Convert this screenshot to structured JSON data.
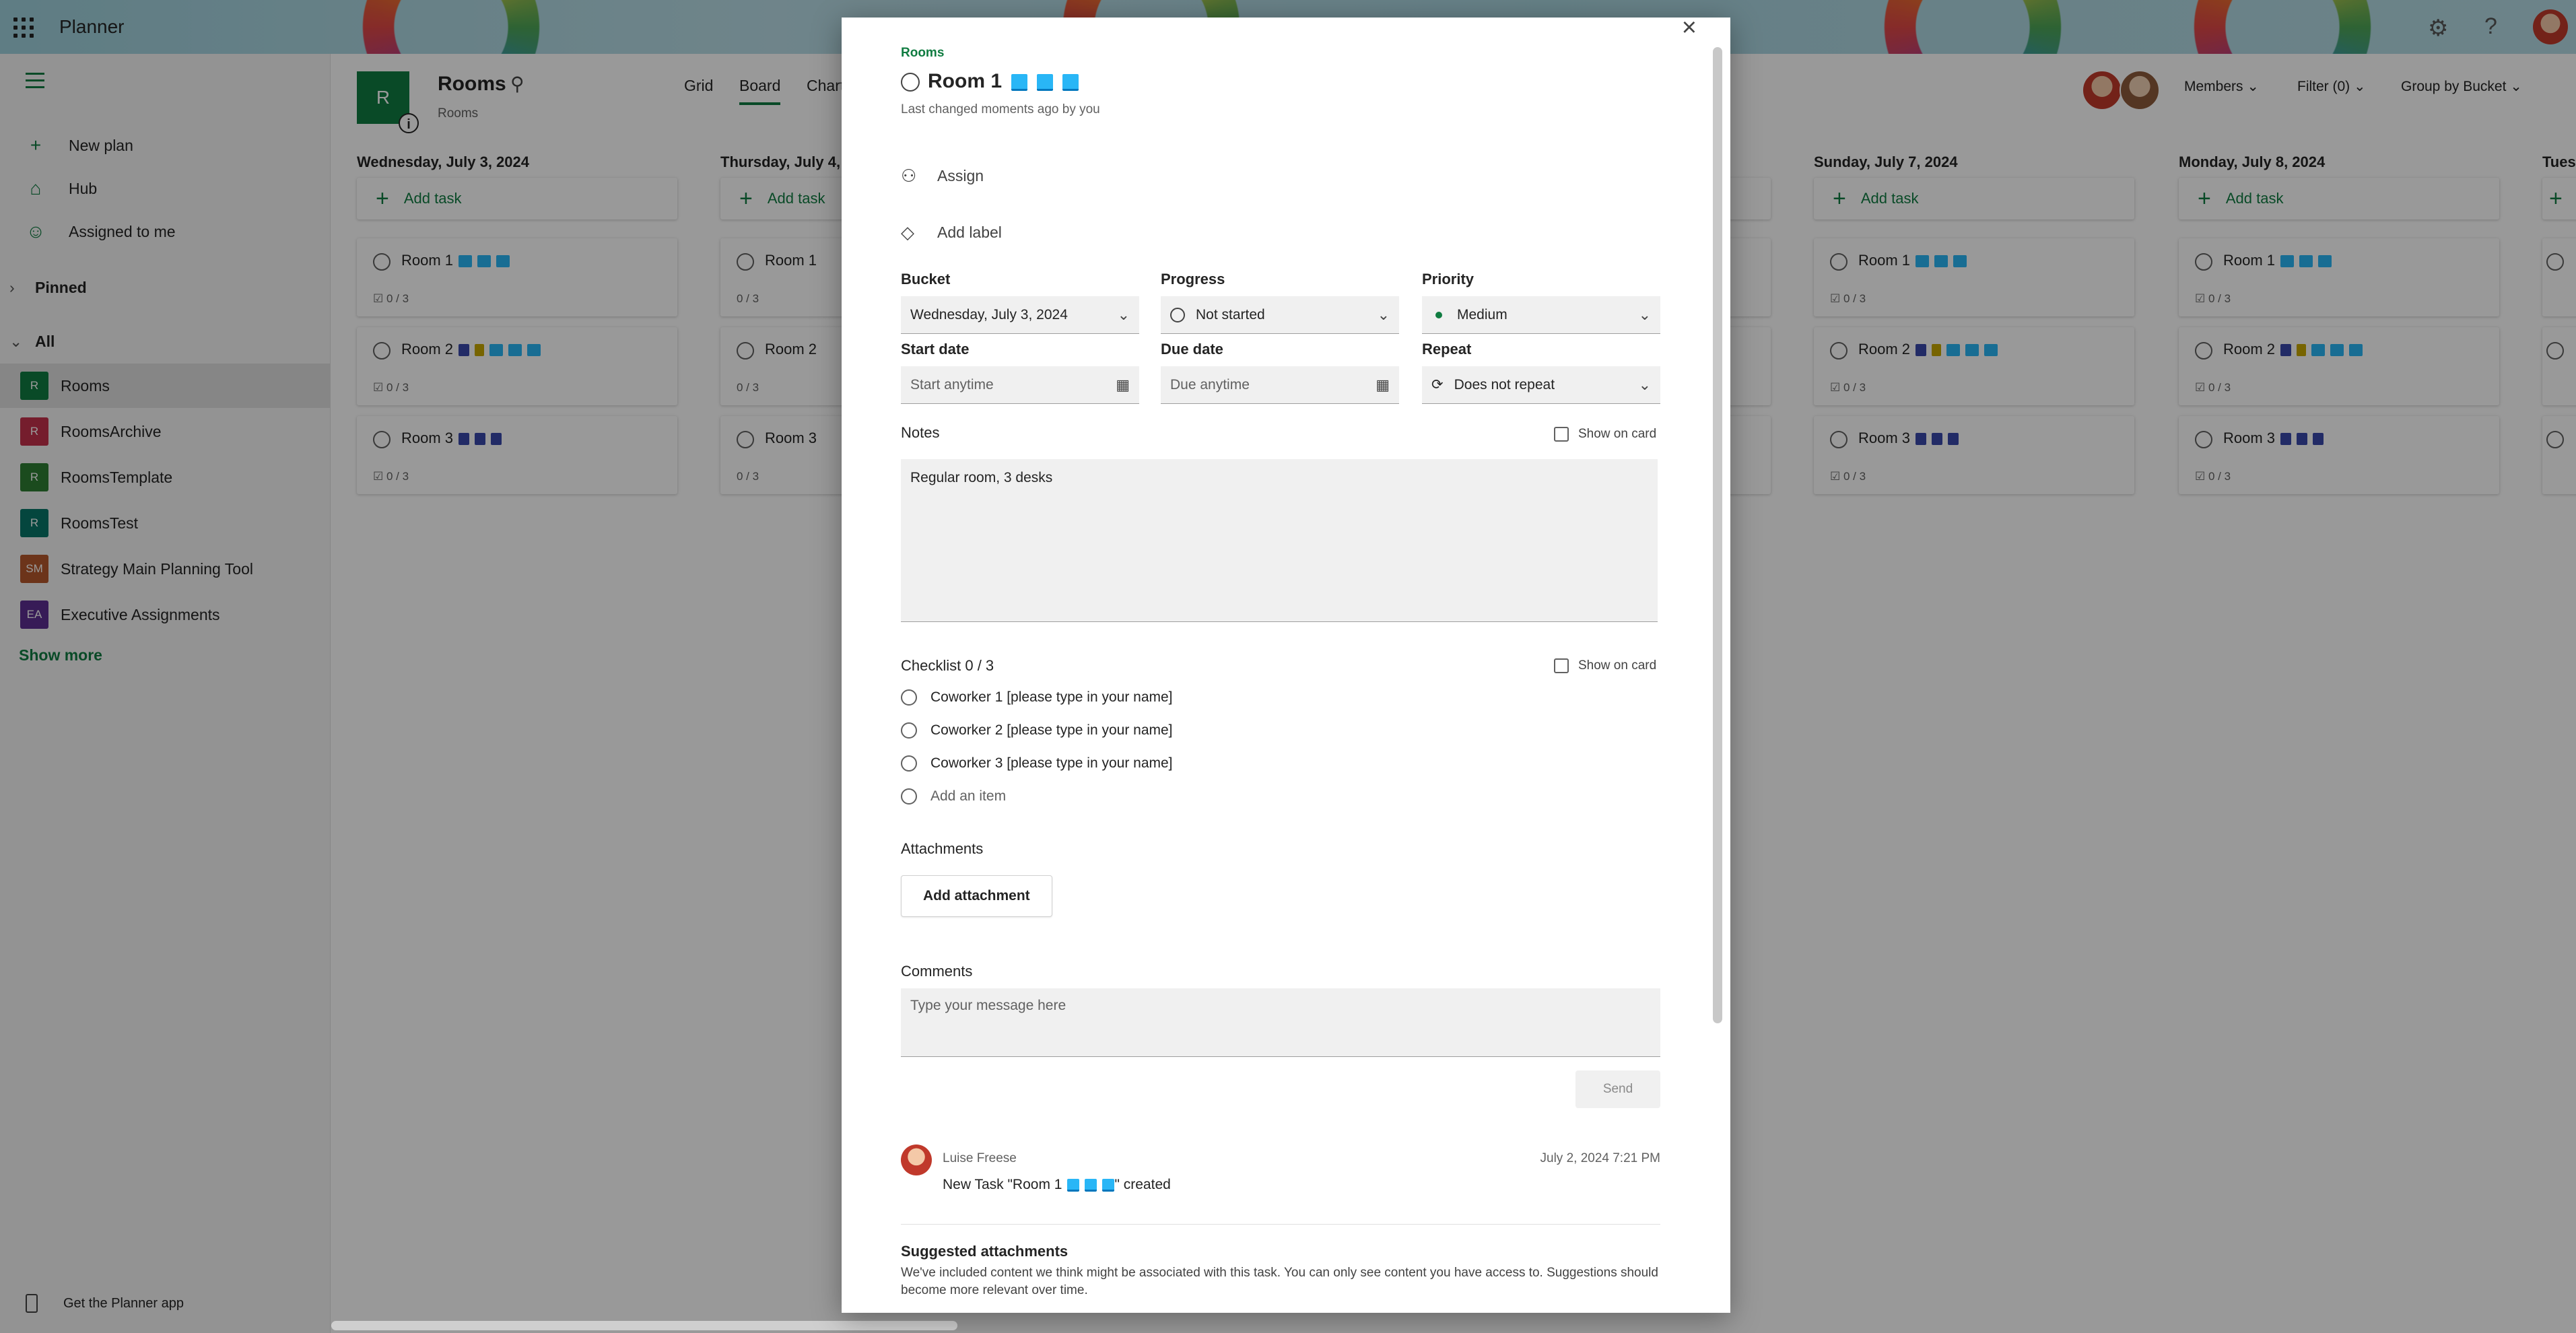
{
  "app": {
    "title": "Planner"
  },
  "sidenav": {
    "items": [
      {
        "label": "New plan",
        "icon": "plus-icon"
      },
      {
        "label": "Hub",
        "icon": "home-icon"
      },
      {
        "label": "Assigned to me",
        "icon": "person-icon"
      }
    ],
    "pinned_label": "Pinned",
    "all_label": "All",
    "plans": [
      {
        "label": "Rooms",
        "initials": "R",
        "color": "#107c41",
        "active": true
      },
      {
        "label": "RoomsArchive",
        "initials": "R",
        "color": "#c4314b",
        "active": false
      },
      {
        "label": "RoomsTemplate",
        "initials": "R",
        "color": "#2e7d32",
        "active": false
      },
      {
        "label": "RoomsTest",
        "initials": "R",
        "color": "#077568",
        "active": false
      },
      {
        "label": "Strategy Main Planning Tool",
        "initials": "SM",
        "color": "#b4582c",
        "active": false
      },
      {
        "label": "Executive Assignments",
        "initials": "EA",
        "color": "#5c2e91",
        "active": false
      }
    ],
    "show_more": "Show more",
    "get_app": "Get the Planner app"
  },
  "plan_header": {
    "initial": "R",
    "name": "Rooms",
    "subtitle": "Rooms",
    "tabs": [
      "Grid",
      "Board",
      "Charts"
    ],
    "active_tab": "Board",
    "members_label": "Members",
    "filter_label": "Filter (0)",
    "group_label": "Group by Bucket"
  },
  "board": {
    "add_task_label": "Add task",
    "buckets": [
      {
        "title": "Wednesday, July 3, 2024"
      },
      {
        "title": "Thursday, July 4,"
      },
      {
        "title": "Sunday, July 7, 2024"
      },
      {
        "title": "Monday, July 8, 2024"
      },
      {
        "title": "Tues"
      }
    ],
    "tasks": [
      {
        "title": "Room 1",
        "progress": "0 / 3"
      },
      {
        "title": "Room 2",
        "progress": "0 / 3"
      },
      {
        "title": "Room 3",
        "progress": "0 / 3"
      }
    ]
  },
  "dialog": {
    "plan_name": "Rooms",
    "task_title": "Room 1",
    "last_changed": "Last changed moments ago by you",
    "assign": "Assign",
    "add_label": "Add label",
    "bucket": {
      "label": "Bucket",
      "value": "Wednesday, July 3, 2024"
    },
    "progress": {
      "label": "Progress",
      "value": "Not started"
    },
    "priority": {
      "label": "Priority",
      "value": "Medium"
    },
    "start_date": {
      "label": "Start date",
      "placeholder": "Start anytime"
    },
    "due_date": {
      "label": "Due date",
      "placeholder": "Due anytime"
    },
    "repeat": {
      "label": "Repeat",
      "value": "Does not repeat"
    },
    "notes": {
      "label": "Notes",
      "show_on_card": "Show on card",
      "value": "Regular room, 3 desks"
    },
    "checklist": {
      "label": "Checklist 0 / 3",
      "show_on_card": "Show on card",
      "items": [
        "Coworker 1 [please type in your name]",
        "Coworker 2 [please type in your name]",
        "Coworker 3 [please type in your name]"
      ],
      "add_item": "Add an item"
    },
    "attachments": {
      "label": "Attachments",
      "button": "Add attachment"
    },
    "comments": {
      "label": "Comments",
      "placeholder": "Type your message here",
      "send": "Send",
      "entry": {
        "author": "Luise Freese",
        "date": "July 2, 2024 7:21 PM",
        "text_before": "New Task \"Room 1",
        "text_after": "\" created"
      }
    },
    "suggested": {
      "title": "Suggested attachments",
      "text": "We've included content we think might be associated with this task. You can only see content you have access to. Suggestions should become more relevant over time."
    }
  }
}
